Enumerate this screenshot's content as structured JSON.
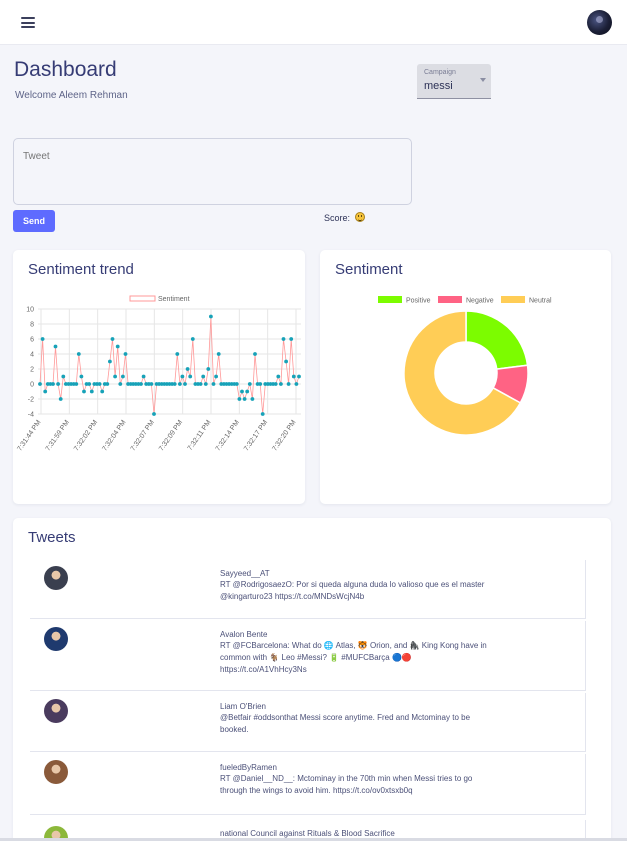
{
  "header": {
    "menu_icon": "hamburger-menu-icon",
    "avatar_icon": "user-avatar"
  },
  "page": {
    "title": "Dashboard",
    "welcome": "Welcome Aleem Rehman"
  },
  "campaign": {
    "label": "Campaign",
    "value": "messi"
  },
  "composer": {
    "placeholder": "Tweet",
    "send_label": "Send",
    "score_label": "Score:",
    "score_icon": "smiley-face-icon"
  },
  "colors": {
    "accent": "#5e6bff",
    "positive": "#7cfc00",
    "negative": "#ff6384",
    "neutral": "#ffcd56",
    "trend_line": "#ff9999",
    "trend_point": "#17a2b8"
  },
  "trend_card": {
    "title": "Sentiment trend"
  },
  "sentiment_card": {
    "title": "Sentiment"
  },
  "tweets_card": {
    "title": "Tweets"
  },
  "chart_data": [
    {
      "type": "line",
      "title": "Sentiment trend",
      "series": [
        {
          "name": "Sentiment",
          "values": [
            0,
            6,
            -1,
            0,
            0,
            0,
            5,
            0,
            -2,
            1,
            0,
            0,
            0,
            0,
            0,
            4,
            1,
            -1,
            0,
            0,
            -1,
            0,
            0,
            0,
            -1,
            0,
            0,
            3,
            6,
            1,
            5,
            0,
            1,
            4,
            0,
            0,
            0,
            0,
            0,
            0,
            1,
            0,
            0,
            0,
            -4,
            0,
            0,
            0,
            0,
            0,
            0,
            0,
            0,
            4,
            0,
            1,
            0,
            2,
            1,
            6,
            0,
            0,
            0,
            1,
            0,
            2,
            9,
            0,
            1,
            4,
            0,
            0,
            0,
            0,
            0,
            0,
            0,
            -2,
            -1,
            -2,
            -1,
            0,
            -2,
            4,
            0,
            0,
            -4,
            0,
            0,
            0,
            0,
            0,
            1,
            0,
            6,
            3,
            0,
            6,
            1,
            0,
            1
          ]
        }
      ],
      "xticks": [
        "7:31:44 PM",
        "7:31:59 PM",
        "7:32:02 PM",
        "7:32:04 PM",
        "7:32:07 PM",
        "7:32:09 PM",
        "7:32:11 PM",
        "7:32:14 PM",
        "7:32:17 PM",
        "7:32:20 PM"
      ],
      "yticks": [
        10,
        8,
        6,
        4,
        2,
        0,
        -2,
        -4
      ],
      "ylim": [
        -4,
        10
      ],
      "legend": "top",
      "grid": true
    },
    {
      "type": "pie",
      "title": "Sentiment",
      "categories": [
        "Positive",
        "Negative",
        "Neutral"
      ],
      "values": [
        23,
        10,
        67
      ],
      "legend": "top"
    }
  ],
  "tweets": [
    {
      "user": "Sayyeed__AT",
      "text": "RT @RodrigosaezO: Por si queda alguna duda lo valioso que es el master @kingarturo23 https://t.co/MNDsWcjN4b",
      "avatar_color": "#3a3f4f"
    },
    {
      "user": "Avalon Bente",
      "text": "RT @FCBarcelona: What do 🌐 Atlas, 🐯 Orion, and 🦍 King Kong have in common with 🐐 Leo #Messi? 🔋 #MUFCBarça 🔵🔴 https://t.co/A1VhHcy3Ns",
      "avatar_color": "#1f3a6e"
    },
    {
      "user": "Liam O'Brien",
      "text": "@Betfair #oddsonthat Messi score anytime. Fred and Mctominay to be booked.",
      "avatar_color": "#4a3b5e"
    },
    {
      "user": "fueledByRamen",
      "text": "RT @Daniel__ND__: Mctominay in the 70th min when Messi tries to go through the wings to avoid him. https://t.co/ov0xtsxb0q",
      "avatar_color": "#8a5a3a"
    },
    {
      "user": "national Council against Rituals & Blood Sacrifice",
      "text": "",
      "avatar_color": "#8cb83a"
    }
  ]
}
